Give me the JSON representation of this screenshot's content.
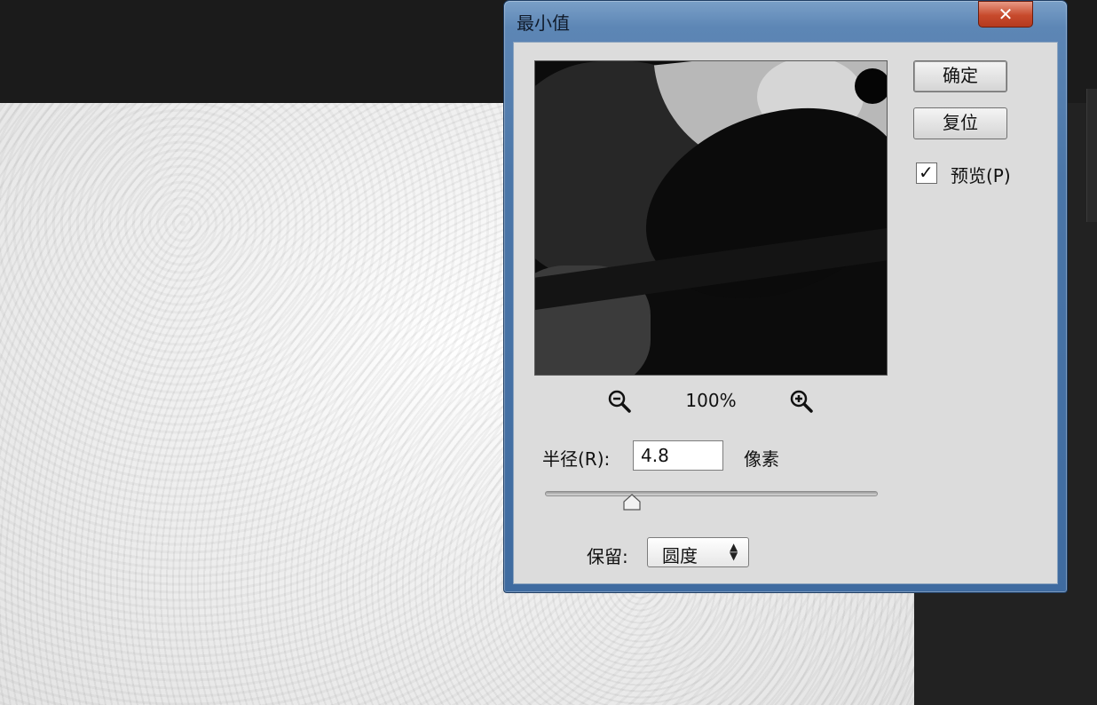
{
  "dialog": {
    "title": "最小值",
    "ok_label": "确定",
    "reset_label": "复位",
    "preview_label": "预览(P)",
    "preview_checked": true
  },
  "zoom": {
    "level": "100%"
  },
  "radius": {
    "label": "半径(R):",
    "value": "4.8",
    "unit": "像素",
    "slider_fraction": 0.26
  },
  "preserve": {
    "label": "保留:",
    "value": "圆度"
  },
  "icons": [
    "close-icon",
    "zoom-out-icon",
    "zoom-in-icon",
    "checkmark-icon",
    "select-arrows-icon"
  ]
}
